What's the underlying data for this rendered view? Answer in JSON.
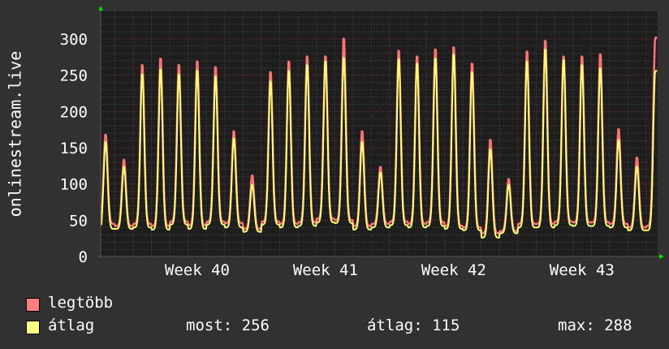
{
  "chart_data": {
    "type": "line",
    "title": "",
    "ylabel": "onlinestream.live",
    "xlabel": "",
    "ylim": [
      0,
      300
    ],
    "xlim_days": [
      0,
      30.4
    ],
    "yticks": [
      0,
      50,
      100,
      150,
      200,
      250,
      300
    ],
    "ytick_labels": [
      "0",
      "50",
      "100",
      "150",
      "200",
      "250",
      "300"
    ],
    "xticks": [
      {
        "label": "Week 40",
        "day": 5.27
      },
      {
        "label": "Week 41",
        "day": 12.27
      },
      {
        "label": "Week 42",
        "day": 19.27
      },
      {
        "label": "Week 43",
        "day": 26.27
      }
    ],
    "week_boundaries_days": [
      1.77,
      8.77,
      15.77,
      22.77,
      29.77
    ],
    "grid": true,
    "legend_position": "bottom-left",
    "series": [
      {
        "name": "legtöbb",
        "color": "#ff7373",
        "daily_peaks": [
          170,
          135,
          268,
          277,
          268,
          273,
          265,
          175,
          113,
          258,
          273,
          280,
          280,
          305,
          175,
          125,
          288,
          280,
          290,
          293,
          270,
          163,
          108,
          287,
          302,
          280,
          280,
          283,
          178,
          138,
          302
        ],
        "daily_troughs": [
          45,
          42,
          45,
          42,
          48,
          43,
          48,
          46,
          38,
          48,
          45,
          47,
          52,
          50,
          42,
          45,
          48,
          45,
          47,
          42,
          40,
          32,
          35,
          45,
          45,
          48,
          47,
          47,
          45,
          40,
          42
        ]
      },
      {
        "name": "átlag",
        "color": "#ffff73",
        "daily_peaks": [
          160,
          125,
          255,
          262,
          255,
          260,
          252,
          165,
          100,
          245,
          260,
          268,
          273,
          278,
          160,
          117,
          276,
          270,
          277,
          283,
          258,
          150,
          100,
          273,
          290,
          275,
          268,
          263,
          163,
          125,
          256
        ],
        "daily_troughs": [
          38,
          38,
          40,
          37,
          44,
          38,
          44,
          40,
          34,
          44,
          40,
          42,
          47,
          46,
          37,
          40,
          43,
          40,
          42,
          38,
          36,
          26,
          32,
          40,
          40,
          43,
          42,
          42,
          40,
          36,
          36
        ]
      }
    ],
    "stats": {
      "most_label": "most:",
      "most": "256",
      "atlag_label": "átlag:",
      "atlag": "115",
      "max_label": "max:",
      "max": "288"
    }
  }
}
